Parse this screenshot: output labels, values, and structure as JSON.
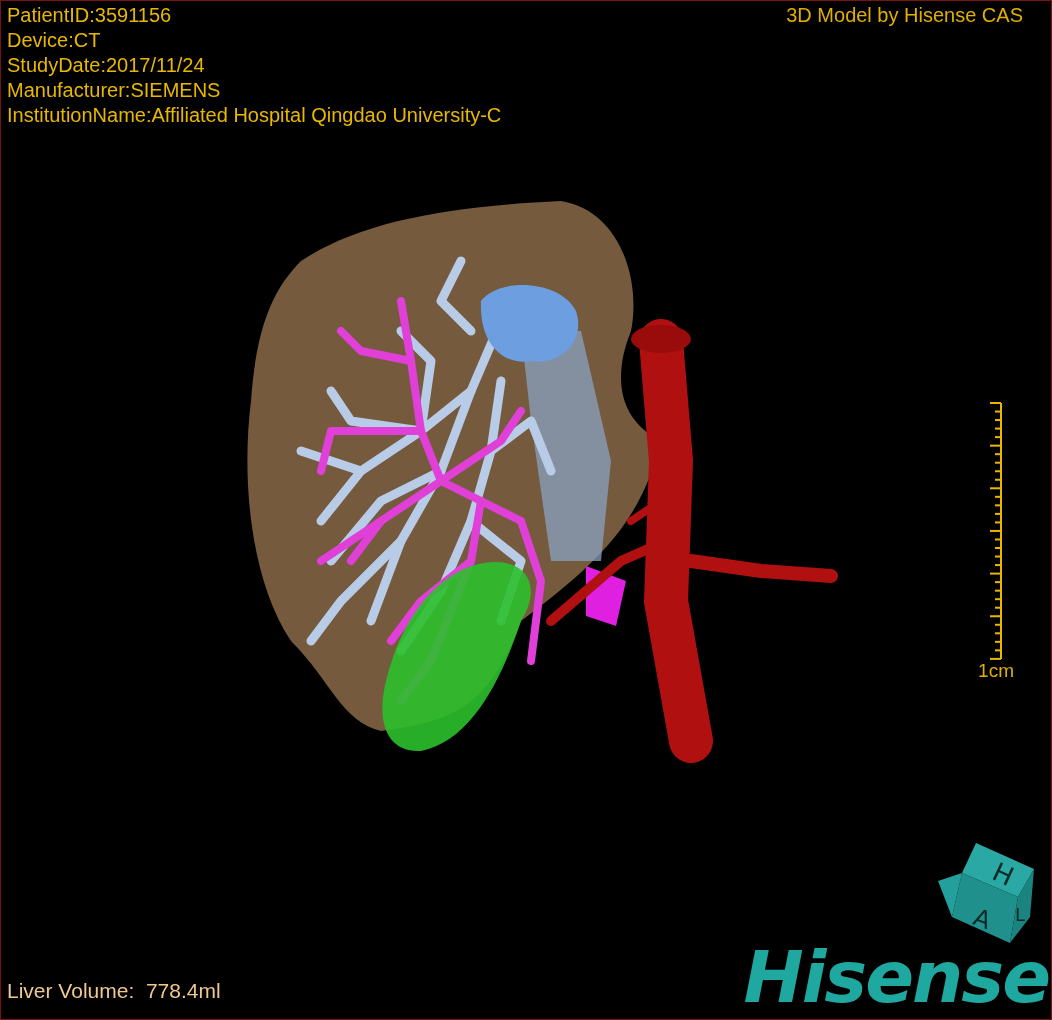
{
  "patient_info": [
    "PatientID:3591156",
    "Device:CT",
    "StudyDate:2017/11/24",
    "Manufacturer:SIEMENS",
    "InstitutionName:Affiliated Hospital Qingdao University-C"
  ],
  "header": "3D Model by Hisense CAS",
  "scale_bar": {
    "label": "1cm"
  },
  "liver_volume": "Liver Volume:  778.4ml",
  "orientation_cube": {
    "top": "H",
    "front": "A",
    "side": "L"
  },
  "logo": "Hisense"
}
